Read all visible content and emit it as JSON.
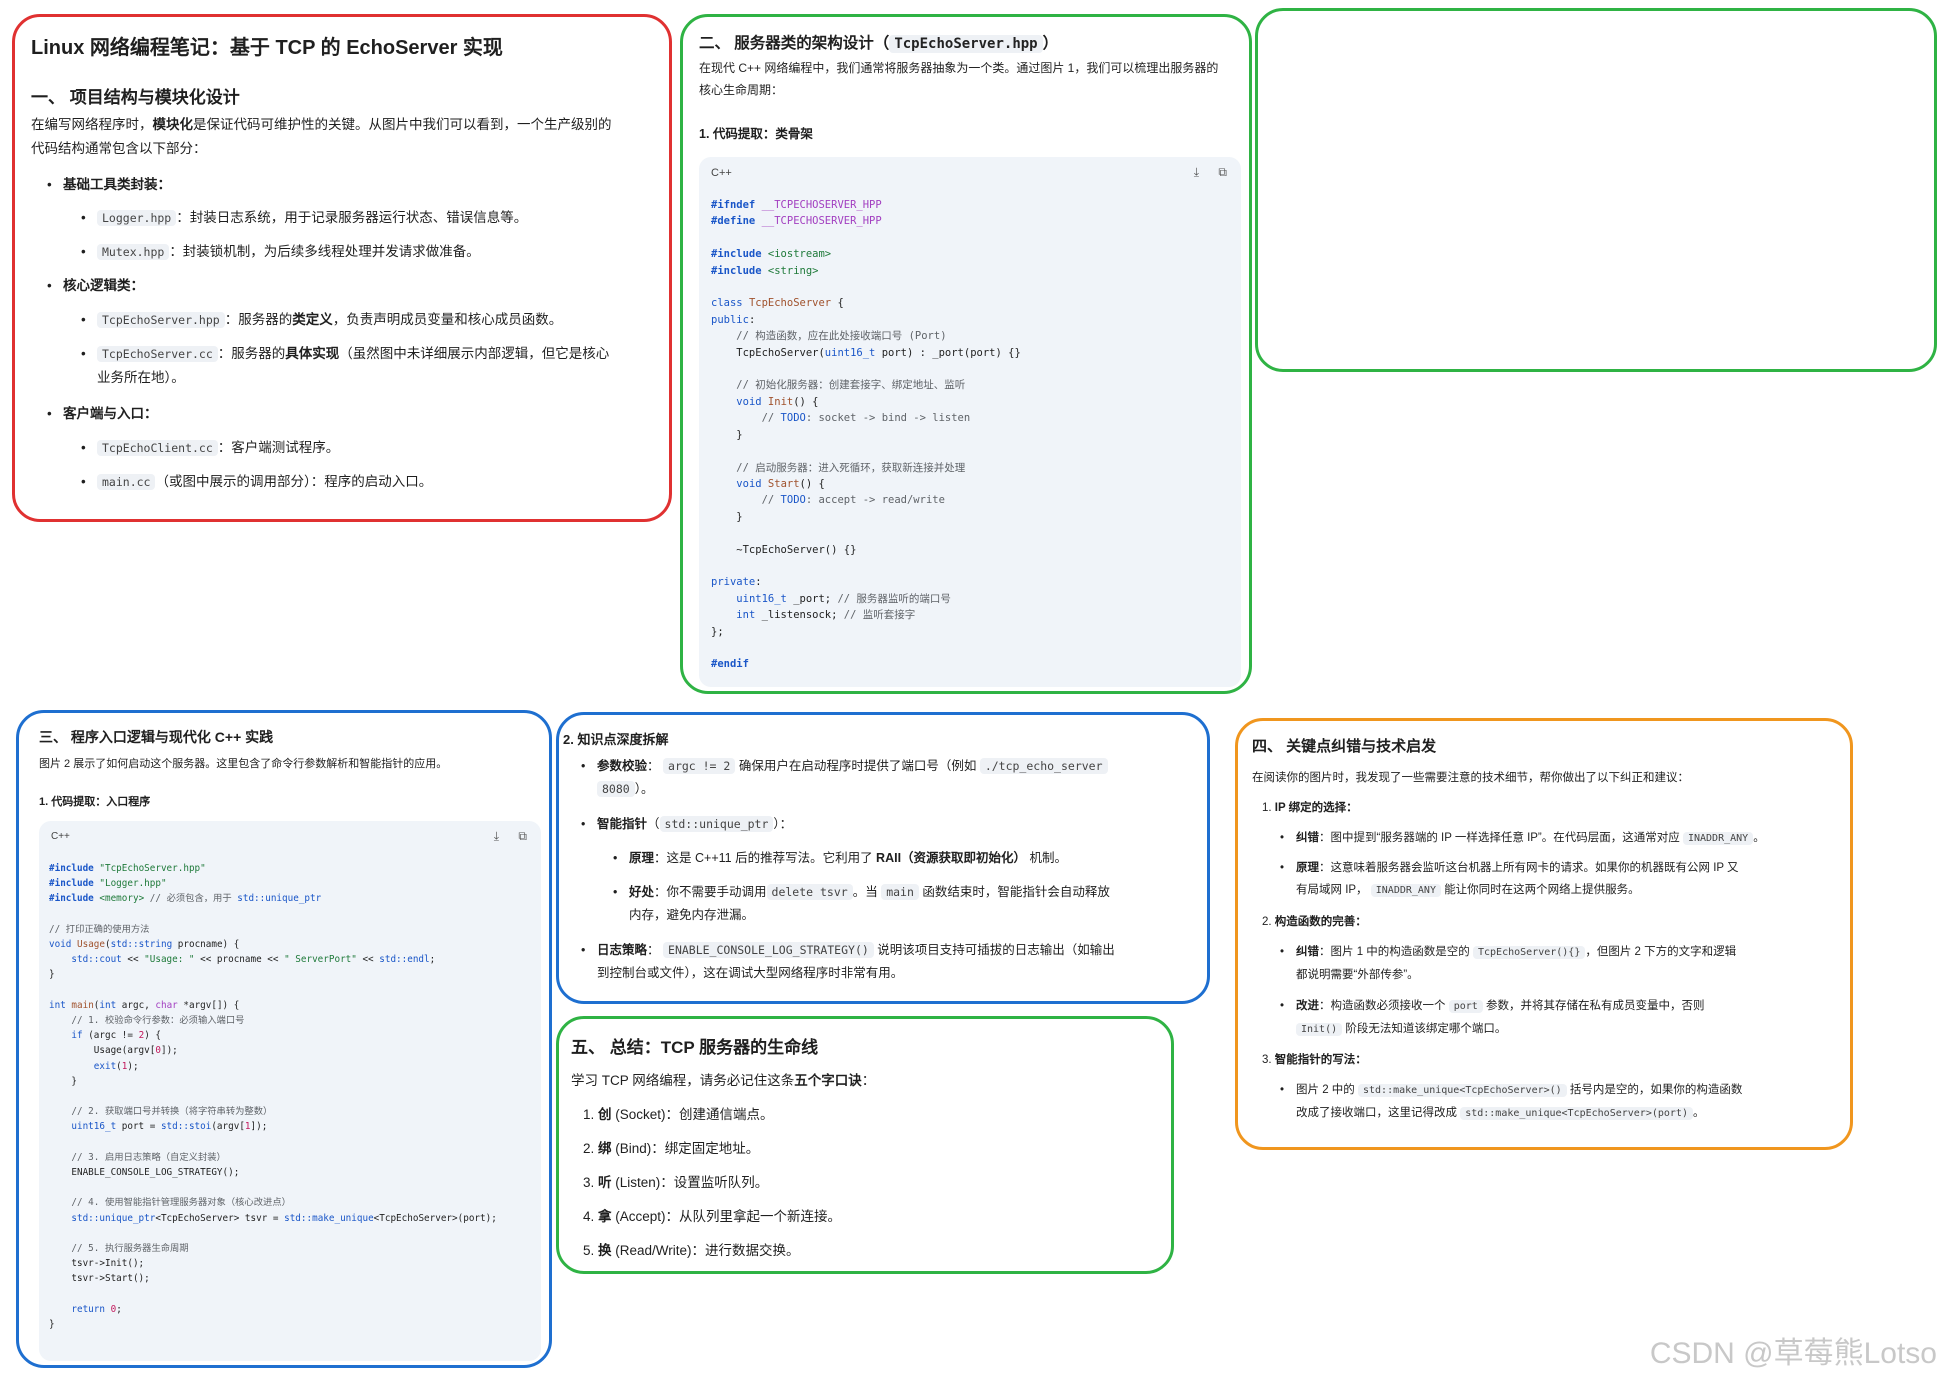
{
  "watermark": "CSDN @草莓熊Lotso",
  "s1": {
    "title": "Linux 网络编程笔记：基于 TCP 的 EchoServer 实现",
    "heading": "一、 项目结构与模块化设计",
    "intro_a": "在编写网络程序时，",
    "intro_b": "模块化",
    "intro_c": "是保证代码可维护性的关键。从图片中我们可以看到，一个生产级别的",
    "intro_d": "代码结构通常包含以下部分：",
    "g1": "基础工具类封装：",
    "g1_i1_code": "Logger.hpp",
    "g1_i1_text": "：封装日志系统，用于记录服务器运行状态、错误信息等。",
    "g1_i2_code": "Mutex.hpp",
    "g1_i2_text": "：封装锁机制，为后续多线程处理并发请求做准备。",
    "g2": "核心逻辑类：",
    "g2_i1_code": "TcpEchoServer.hpp",
    "g2_i1_a": "：服务器的",
    "g2_i1_b": "类定义",
    "g2_i1_c": "，负责声明成员变量和核心成员函数。",
    "g2_i2_code": "TcpEchoServer.cc",
    "g2_i2_a": "：服务器的",
    "g2_i2_b": "具体实现",
    "g2_i2_c": "（虽然图中未详细展示内部逻辑，但它是核心",
    "g2_i2_d": "业务所在地）。",
    "g3": "客户端与入口：",
    "g3_i1_code": "TcpEchoClient.cc",
    "g3_i1_text": "：客户端测试程序。",
    "g3_i2_code": "main.cc",
    "g3_i2_text": "（或图中展示的调用部分）：程序的启动入口。"
  },
  "s2": {
    "heading_a": "二、 服务器类的架构设计（",
    "heading_code": "TcpEchoServer.hpp",
    "heading_b": "）",
    "intro1": "在现代 C++ 网络编程中，我们通常将服务器抽象为一个类。通过图片 1，我们可以梳理出服务器的",
    "intro2": "核心生命周期：",
    "sub": "1. 代码提取：类骨架",
    "lang": "C++",
    "download_icon": "⤓",
    "copy_icon": "⧉"
  },
  "s3": {
    "heading": "三、 程序入口逻辑与现代化 C++ 实践",
    "intro": "图片 2 展示了如何启动这个服务器。这里包含了命令行参数解析和智能指针的应用。",
    "sub": "1. 代码提取：入口程序",
    "lang": "C++"
  },
  "s4": {
    "heading": "2. 知识点深度拆解",
    "b1_label": "参数校验",
    "b1_colon": "：",
    "b1_code1": "argc != 2",
    "b1_text": "确保用户在启动程序时提供了端口号（例如",
    "b1_code2": "./tcp_echo_server",
    "b1_code3": "8080",
    "b1_end": "）。",
    "b2_label": "智能指针",
    "b2_open": "（",
    "b2_code": "std::unique_ptr",
    "b2_close": "）：",
    "b2_s1_label": "原理",
    "b2_s1_a": "：这是 C++11 后的推荐写法。它利用了 ",
    "b2_s1_b": "RAII（资源获取即初始化）",
    "b2_s1_c": " 机制。",
    "b2_s2_label": "好处",
    "b2_s2_a": "：你不需要手动调用",
    "b2_s2_code1": "delete tsvr",
    "b2_s2_b": "。当",
    "b2_s2_code2": "main",
    "b2_s2_c": "函数结束时，智能指针会自动释放",
    "b2_s2_d": "内存，避免内存泄漏。",
    "b3_label": "日志策略",
    "b3_colon": "：",
    "b3_code": "ENABLE_CONSOLE_LOG_STRATEGY()",
    "b3_text": "说明该项目支持可插拔的日志输出（如输出",
    "b3_text2": "到控制台或文件），这在调试大型网络程序时非常有用。"
  },
  "s5": {
    "heading": "五、 总结：TCP 服务器的生命线",
    "intro_a": "学习 TCP 网络编程，请务必记住这条",
    "intro_b": "五个字口诀",
    "intro_c": "：",
    "items": [
      {
        "n": "1.",
        "k": "创",
        "rest": " (Socket)：创建通信端点。"
      },
      {
        "n": "2.",
        "k": "绑",
        "rest": " (Bind)：绑定固定地址。"
      },
      {
        "n": "3.",
        "k": "听",
        "rest": " (Listen)：设置监听队列。"
      },
      {
        "n": "4.",
        "k": "拿",
        "rest": " (Accept)：从队列里拿起一个新连接。"
      },
      {
        "n": "5.",
        "k": "换",
        "rest": " (Read/Write)：进行数据交换。"
      }
    ]
  },
  "s6": {
    "heading": "四、 关键点纠错与技术启发",
    "intro": "在阅读你的图片时，我发现了一些需要注意的技术细节，帮你做出了以下纠正和建议：",
    "n1": "1.",
    "t1": "IP 绑定的选择：",
    "t1_a_label": "纠错",
    "t1_a_text": "：图中提到“服务器端的 IP 一样选择任意 IP”。在代码层面，这通常对应",
    "t1_a_code": "INADDR_ANY",
    "t1_a_end": "。",
    "t1_b_label": "原理",
    "t1_b_text": "：这意味着服务器会监听这台机器上所有网卡的请求。如果你的机器既有公网 IP 又",
    "t1_b_text2a": "有局域网 IP，",
    "t1_b_code": "INADDR_ANY",
    "t1_b_text2b": "能让你同时在这两个网络上提供服务。",
    "n2": "2.",
    "t2": "构造函数的完善：",
    "t2_a_label": "纠错",
    "t2_a_text": "：图片 1 中的构造函数是空的",
    "t2_a_code": "TcpEchoServer(){}",
    "t2_a_text2": "，但图片 2 下方的文字和逻辑",
    "t2_a_text3": "都说明需要“外部传参”。",
    "t2_b_label": "改进",
    "t2_b_text": "：构造函数必须接收一个",
    "t2_b_code": "port",
    "t2_b_text2": "参数，并将其存储在私有成员变量中，否则",
    "t2_b_code2": "Init()",
    "t2_b_text3": "阶段无法知道该绑定哪个端口。",
    "n3": "3.",
    "t3": "智能指针的写法：",
    "t3_a_text": "图片 2 中的",
    "t3_a_code": "std::make_unique<TcpEchoServer>()",
    "t3_a_text2": "括号内是空的，如果你的构造函数",
    "t3_a_text3": "改成了接收端口，这里记得改成",
    "t3_a_code2": "std::make_unique<TcpEchoServer>(port)",
    "t3_a_end": "。"
  }
}
